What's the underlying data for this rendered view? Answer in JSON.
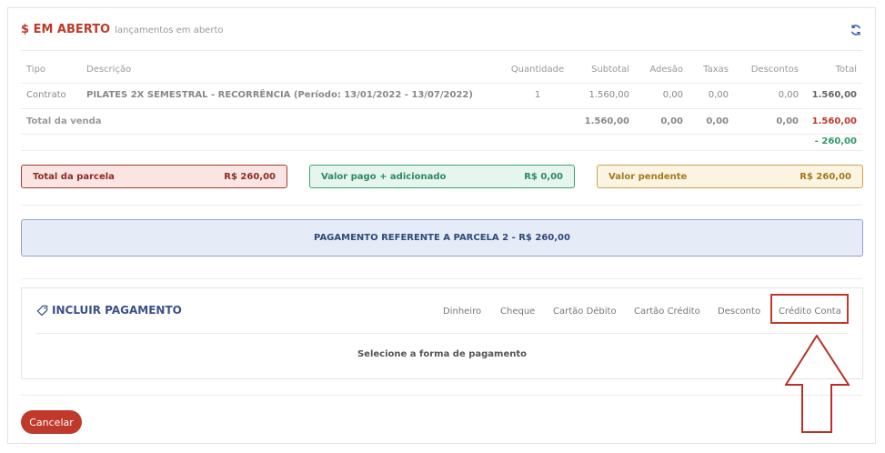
{
  "header": {
    "title": "$ EM ABERTO",
    "subtitle": "lançamentos em aberto",
    "refresh_icon": "refresh-icon",
    "title_color": "#c0392b"
  },
  "table": {
    "headers": [
      "Tipo",
      "Descrição",
      "Quantidade",
      "Subtotal",
      "Adesão",
      "Taxas",
      "Descontos",
      "Total"
    ],
    "row": {
      "tipo": "Contrato",
      "descricao": "PILATES 2X SEMESTRAL - RECORRÊNCIA (Período: 13/01/2022 - 13/07/2022)",
      "quantidade": "1",
      "subtotal": "1.560,00",
      "adesao": "0,00",
      "taxas": "0,00",
      "descontos": "0,00",
      "total": "1.560,00"
    },
    "totals": {
      "label": "Total da venda",
      "subtotal": "1.560,00",
      "adesao": "0,00",
      "taxas": "0,00",
      "descontos": "0,00",
      "total": "1.560,00",
      "payment": "- 260,00"
    }
  },
  "summary": {
    "parcela": {
      "label": "Total da parcela",
      "value": "R$ 260,00",
      "color": "#a33a33"
    },
    "pago": {
      "label": "Valor pago + adicionado",
      "value": "R$ 0,00",
      "color": "#3aa47a"
    },
    "pendente": {
      "label": "Valor pendente",
      "value": "R$ 260,00",
      "color": "#c9a24f"
    }
  },
  "banner": {
    "text": "PAGAMENTO REFERENTE A PARCELA 2 - R$ 260,00"
  },
  "payment": {
    "title": "INCLUIR PAGAMENTO",
    "icon": "tag-icon",
    "methods": [
      "Dinheiro",
      "Cheque",
      "Cartão Débito",
      "Cartão Crédito",
      "Desconto",
      "Crédito Conta"
    ],
    "hint": "Selecione a forma de pagamento"
  },
  "actions": {
    "cancel_label": "Cancelar",
    "cancel_color": "#c0392b"
  }
}
